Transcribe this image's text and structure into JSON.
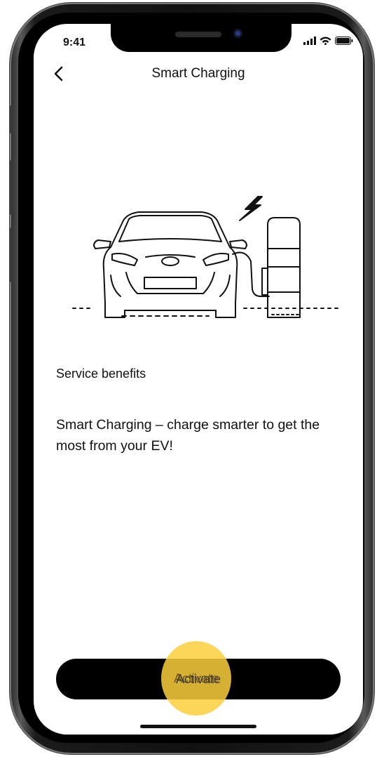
{
  "status_bar": {
    "time": "9:41"
  },
  "header": {
    "title": "Smart Charging",
    "back_icon": "chevron-left-icon"
  },
  "content": {
    "section_title": "Service benefits",
    "description": "Smart Charging – charge smarter to get the most from your EV!"
  },
  "action": {
    "activate_label": "Activate"
  },
  "colors": {
    "button": "#000000",
    "tap_highlight": "#FCCF3C",
    "text": "#111111"
  }
}
